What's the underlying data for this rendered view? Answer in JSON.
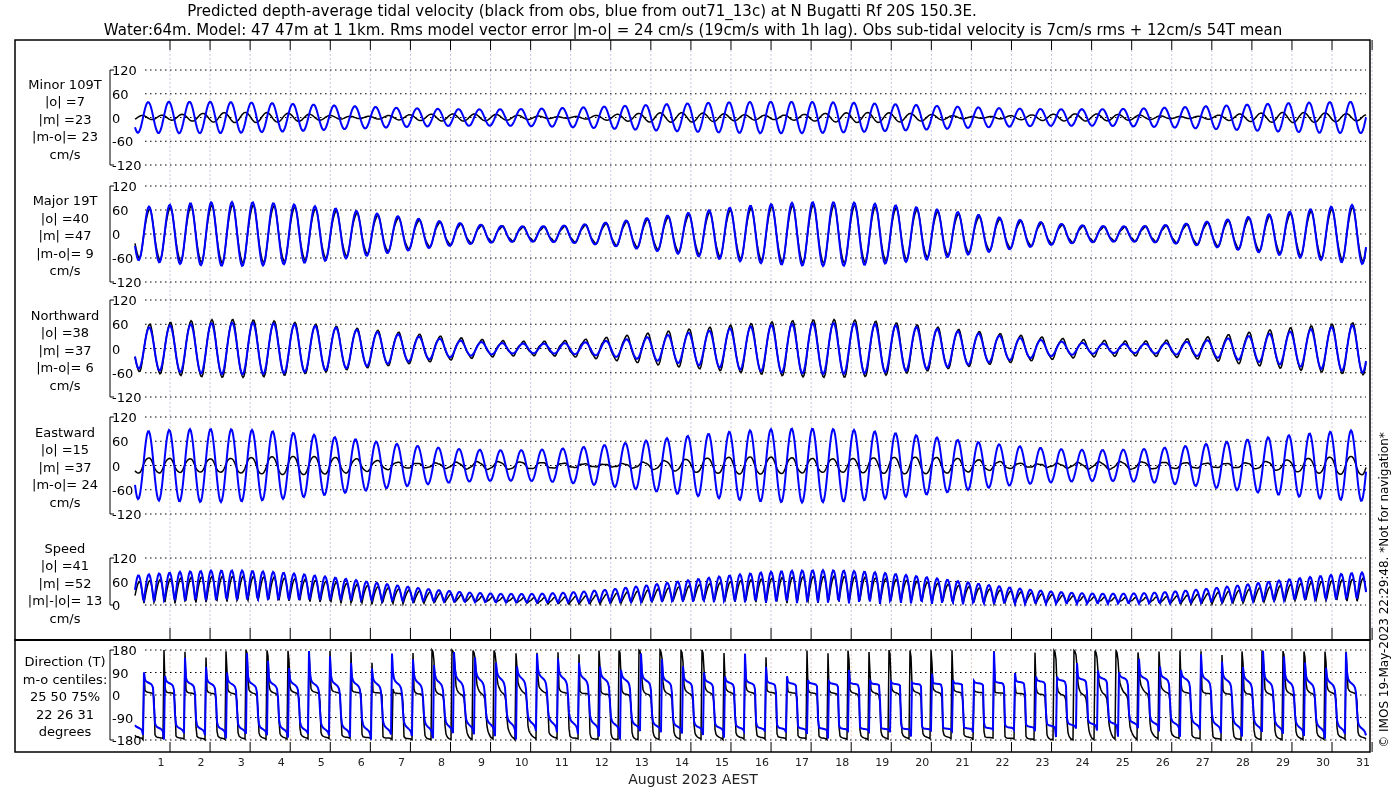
{
  "title_lines": [
    "Predicted depth-average tidal velocity (black from obs, blue from out71_13c) at N Bugatti Rf 20S 150.3E.",
    "Water:64m. Model: 47 47m at 1 1km. Rms model vector error |m-o| = 24 cm/s (19cm/s with 1h lag). Obs sub-tidal velocity is 7cm/s rms + 12cm/s 54T mean"
  ],
  "panels": [
    {
      "kind": "minor",
      "label_lines": [
        "Minor 109T",
        "|o| =7",
        "|m| =23",
        "|m-o|= 23",
        "cm/s"
      ],
      "y_tick_labels": [
        "120",
        "60",
        "0",
        "-60",
        "-120"
      ]
    },
    {
      "kind": "major",
      "label_lines": [
        "Major 19T",
        "|o| =40",
        "|m| =47",
        "|m-o|= 9",
        "cm/s"
      ],
      "y_tick_labels": [
        "120",
        "60",
        "0",
        "-60",
        "-120"
      ]
    },
    {
      "kind": "northward",
      "label_lines": [
        "Northward",
        "|o| =38",
        "|m| =37",
        "|m-o|= 6",
        "cm/s"
      ],
      "y_tick_labels": [
        "120",
        "60",
        "0",
        "-60",
        "-120"
      ]
    },
    {
      "kind": "eastward",
      "label_lines": [
        "Eastward",
        "|o| =15",
        "|m| =37",
        "|m-o|= 24",
        "cm/s"
      ],
      "y_tick_labels": [
        "120",
        "60",
        "0",
        "-60",
        "-120"
      ]
    },
    {
      "kind": "speed",
      "label_lines": [
        "Speed",
        "|o| =41",
        "|m| =52",
        "|m|-|o|= 13",
        "cm/s"
      ],
      "y_tick_labels": [
        "120",
        "60",
        "0"
      ]
    },
    {
      "kind": "direction",
      "label_lines": [
        "Direction (T)",
        "m-o centiles:",
        "25  50  75%",
        "22  26  31",
        "degrees"
      ],
      "y_tick_labels": [
        "180",
        "90",
        "0",
        "-90",
        "-180"
      ]
    }
  ],
  "x_tick_labels": [
    "1",
    "2",
    "3",
    "4",
    "5",
    "6",
    "7",
    "8",
    "9",
    "10",
    "11",
    "12",
    "13",
    "14",
    "15",
    "16",
    "17",
    "18",
    "19",
    "20",
    "21",
    "22",
    "23",
    "24",
    "25",
    "26",
    "27",
    "28",
    "29",
    "30",
    "31"
  ],
  "x_axis_label": "August 2023 AEST",
  "side_note": "© IMOS 19-May-2023 22:29:48.  *Not for navigation*"
}
